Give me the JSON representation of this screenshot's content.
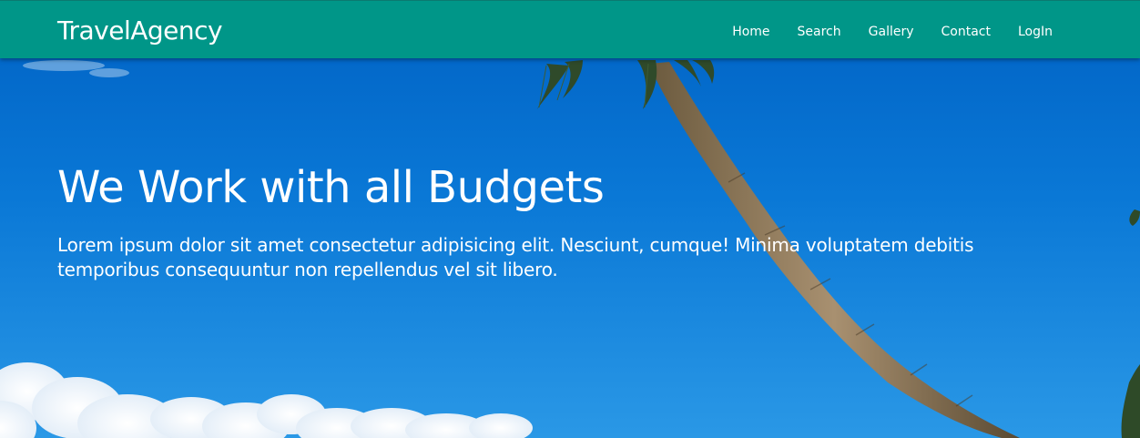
{
  "navbar": {
    "brand": "TravelAgency",
    "links": [
      {
        "label": "Home"
      },
      {
        "label": "Search"
      },
      {
        "label": "Gallery"
      },
      {
        "label": "Contact"
      },
      {
        "label": "LogIn"
      }
    ],
    "background_color": "#009688"
  },
  "hero": {
    "title": "We Work with all Budgets",
    "text": "Lorem ipsum dolor sit amet consectetur adipisicing elit. Nesciunt, cumque! Minima voluptatem debitis temporibus consequuntur non repellendus vel sit libero.",
    "background_image": "tropical beach sky with palm tree and clouds"
  }
}
